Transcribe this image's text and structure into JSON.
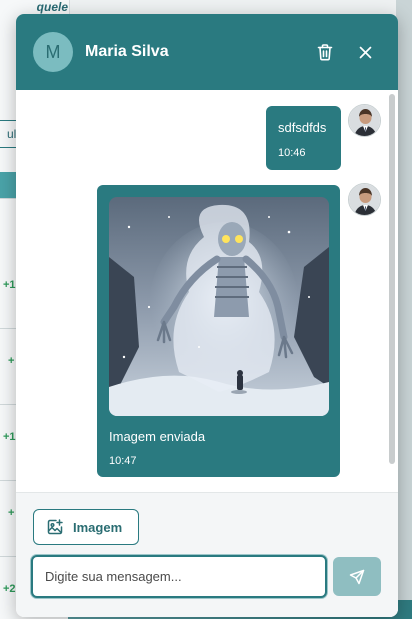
{
  "background": {
    "top_text": "quele\nma",
    "tab_text": "ulo",
    "numbers": [
      "+1",
      "+",
      "+1",
      "+",
      "+2"
    ]
  },
  "chat": {
    "contact_initial": "M",
    "contact_name": "Maria Silva",
    "header_icons": [
      "trash-icon",
      "close-icon"
    ],
    "accent_color": "#2a7a80",
    "messages": [
      {
        "text": "sdfsdfds",
        "time": "10:46",
        "sender": "me"
      },
      {
        "image": "ghost-illustration",
        "caption": "Imagem enviada",
        "time": "10:47",
        "sender": "me"
      }
    ],
    "composer": {
      "image_button_label": "Imagem",
      "input_placeholder": "Digite sua mensagem...",
      "input_value": ""
    }
  }
}
